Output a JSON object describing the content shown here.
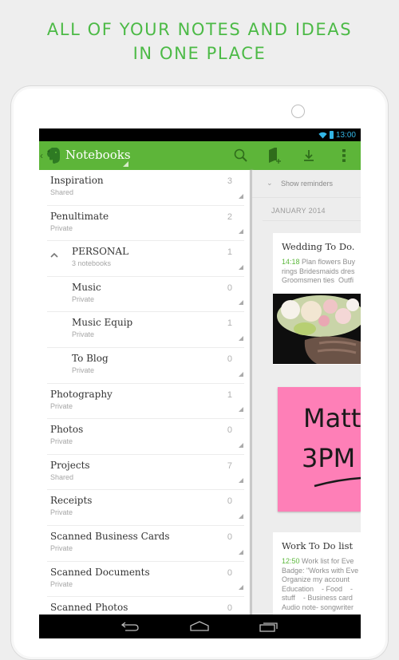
{
  "headline": {
    "line1": "ALL OF YOUR NOTES AND IDEAS",
    "line2": "IN ONE PLACE",
    "color": "#4cba46"
  },
  "status_bar": {
    "time": "13:00",
    "icons": [
      "wifi-icon",
      "battery-icon"
    ],
    "accent": "#33b5e5"
  },
  "action_bar": {
    "title": "Notebooks",
    "color": "#5db539",
    "actions": [
      "search-icon",
      "new-notebook-icon",
      "sync-download-icon",
      "overflow-menu-icon"
    ]
  },
  "notebooks": [
    {
      "name": "Inspiration",
      "sub": "Shared",
      "count": "3",
      "child": false
    },
    {
      "name": "Penultimate",
      "sub": "Private",
      "count": "2",
      "child": false
    },
    {
      "name": "PERSONAL",
      "sub": "3 notebooks",
      "count": "1",
      "child": true,
      "stack": true
    },
    {
      "name": "Music",
      "sub": "Private",
      "count": "0",
      "child": true
    },
    {
      "name": "Music Equip",
      "sub": "Private",
      "count": "1",
      "child": true
    },
    {
      "name": "To Blog",
      "sub": "Private",
      "count": "0",
      "child": true
    },
    {
      "name": "Photography",
      "sub": "Private",
      "count": "1",
      "child": false
    },
    {
      "name": "Photos",
      "sub": "Private",
      "count": "0",
      "child": false
    },
    {
      "name": "Projects",
      "sub": "Shared",
      "count": "7",
      "child": false
    },
    {
      "name": "Receipts",
      "sub": "Private",
      "count": "0",
      "child": false
    },
    {
      "name": "Scanned Business Cards",
      "sub": "Private",
      "count": "0",
      "child": false
    },
    {
      "name": "Scanned Documents",
      "sub": "Private",
      "count": "0",
      "child": false
    },
    {
      "name": "Scanned Photos",
      "sub": "",
      "count": "0",
      "child": false
    }
  ],
  "notes_panel": {
    "show_reminders": "Show reminders",
    "month": "JANUARY 2014",
    "cards": [
      {
        "title": "Wedding To Do.",
        "time": "14:18",
        "snippet_first": " Plan flowers Buy",
        "snippet_rest": "rings Bridesmaids dres\nGroomsmen ties  Outfi"
      },
      {
        "title": "Work To Do list",
        "time": "12:50",
        "snippet_first": " Work list for Eve",
        "snippet_rest": "Badge: \"Works with Eve\nOrganize my account\nEducation    - Food    -\nstuff    - Business card\nAudio note- songwriter"
      }
    ],
    "sticky_note": {
      "line1": "Matt",
      "line2": "3PM",
      "color": "#fe7fb7"
    }
  },
  "nav_bar": {
    "buttons": [
      "back-icon",
      "home-icon",
      "recent-apps-icon"
    ]
  }
}
